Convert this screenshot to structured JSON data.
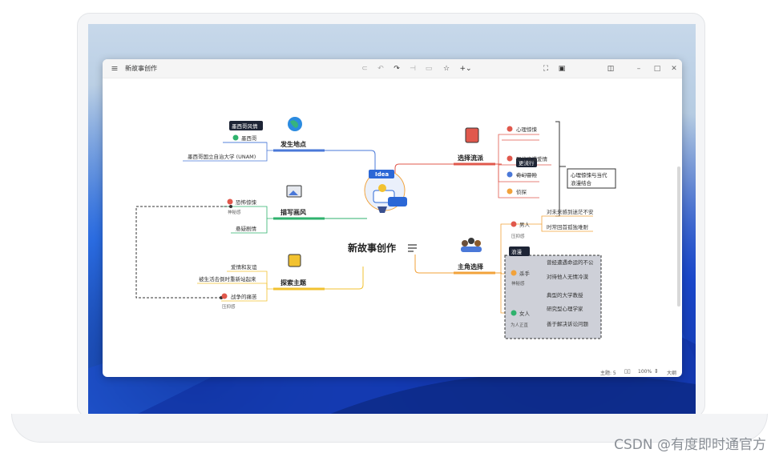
{
  "app": {
    "title": "新故事创作"
  },
  "watermark": "CSDN @有度即时通官方",
  "status": {
    "topics_label": "主题: 5",
    "zoom": "100%",
    "outline": "大纲"
  },
  "central": {
    "label": "新故事创作",
    "badge": "Idea"
  },
  "branches": {
    "place": {
      "label": "发生地点",
      "tooltip": "墨西哥风情",
      "child1": "墨西哥",
      "child2": "墨西哥国立自治大学 (UNAM)"
    },
    "style": {
      "label": "描写画风",
      "child1": "恐怖惊悚",
      "child1_note": "神秘感",
      "child2": "悬疑剧情"
    },
    "theme": {
      "label": "探索主题",
      "child1": "爱情和友谊",
      "child2": "被生活击倒时重新站起来",
      "child3": "战争的痛苦",
      "child3_note": "压抑感"
    },
    "genre": {
      "label": "选择流派",
      "tooltip": "更流行",
      "items": [
        "心理惊悚",
        "现代浪漫爱情",
        "奇幻冒险",
        "侦探"
      ],
      "summary": "心理惊悚与当代浪漫结合"
    },
    "role": {
      "label": "主角选择",
      "male": {
        "label": "男人",
        "note": "压抑感",
        "c1": "对未来感到迷茫不安",
        "c2": "时常回首孤独难耐"
      },
      "group_label": "浪漫",
      "killer": {
        "label": "杀手",
        "note": "神秘感",
        "c1": "曾经遭遇命运的不公",
        "c2": "对待他人无情冷漠"
      },
      "female": {
        "label": "女人",
        "note": "为人正直",
        "c1": "典型的大学教授",
        "c2": "研究型心理学家",
        "c3": "善于解决诉讼问题"
      }
    }
  },
  "icons": {
    "menu": "hamburger-icon",
    "undo": "undo-icon",
    "redo": "redo-icon",
    "star": "star-icon",
    "add": "add-icon",
    "fullscreen": "fullscreen-icon",
    "present": "present-icon",
    "panel": "panel-icon",
    "minimize": "minimize-icon",
    "maximize": "maximize-icon",
    "close": "close-icon"
  },
  "colors": {
    "blue": "#4a78d8",
    "green": "#2fb26d",
    "yellow": "#f2c230",
    "red": "#e0584c",
    "orange": "#f2a23a"
  }
}
